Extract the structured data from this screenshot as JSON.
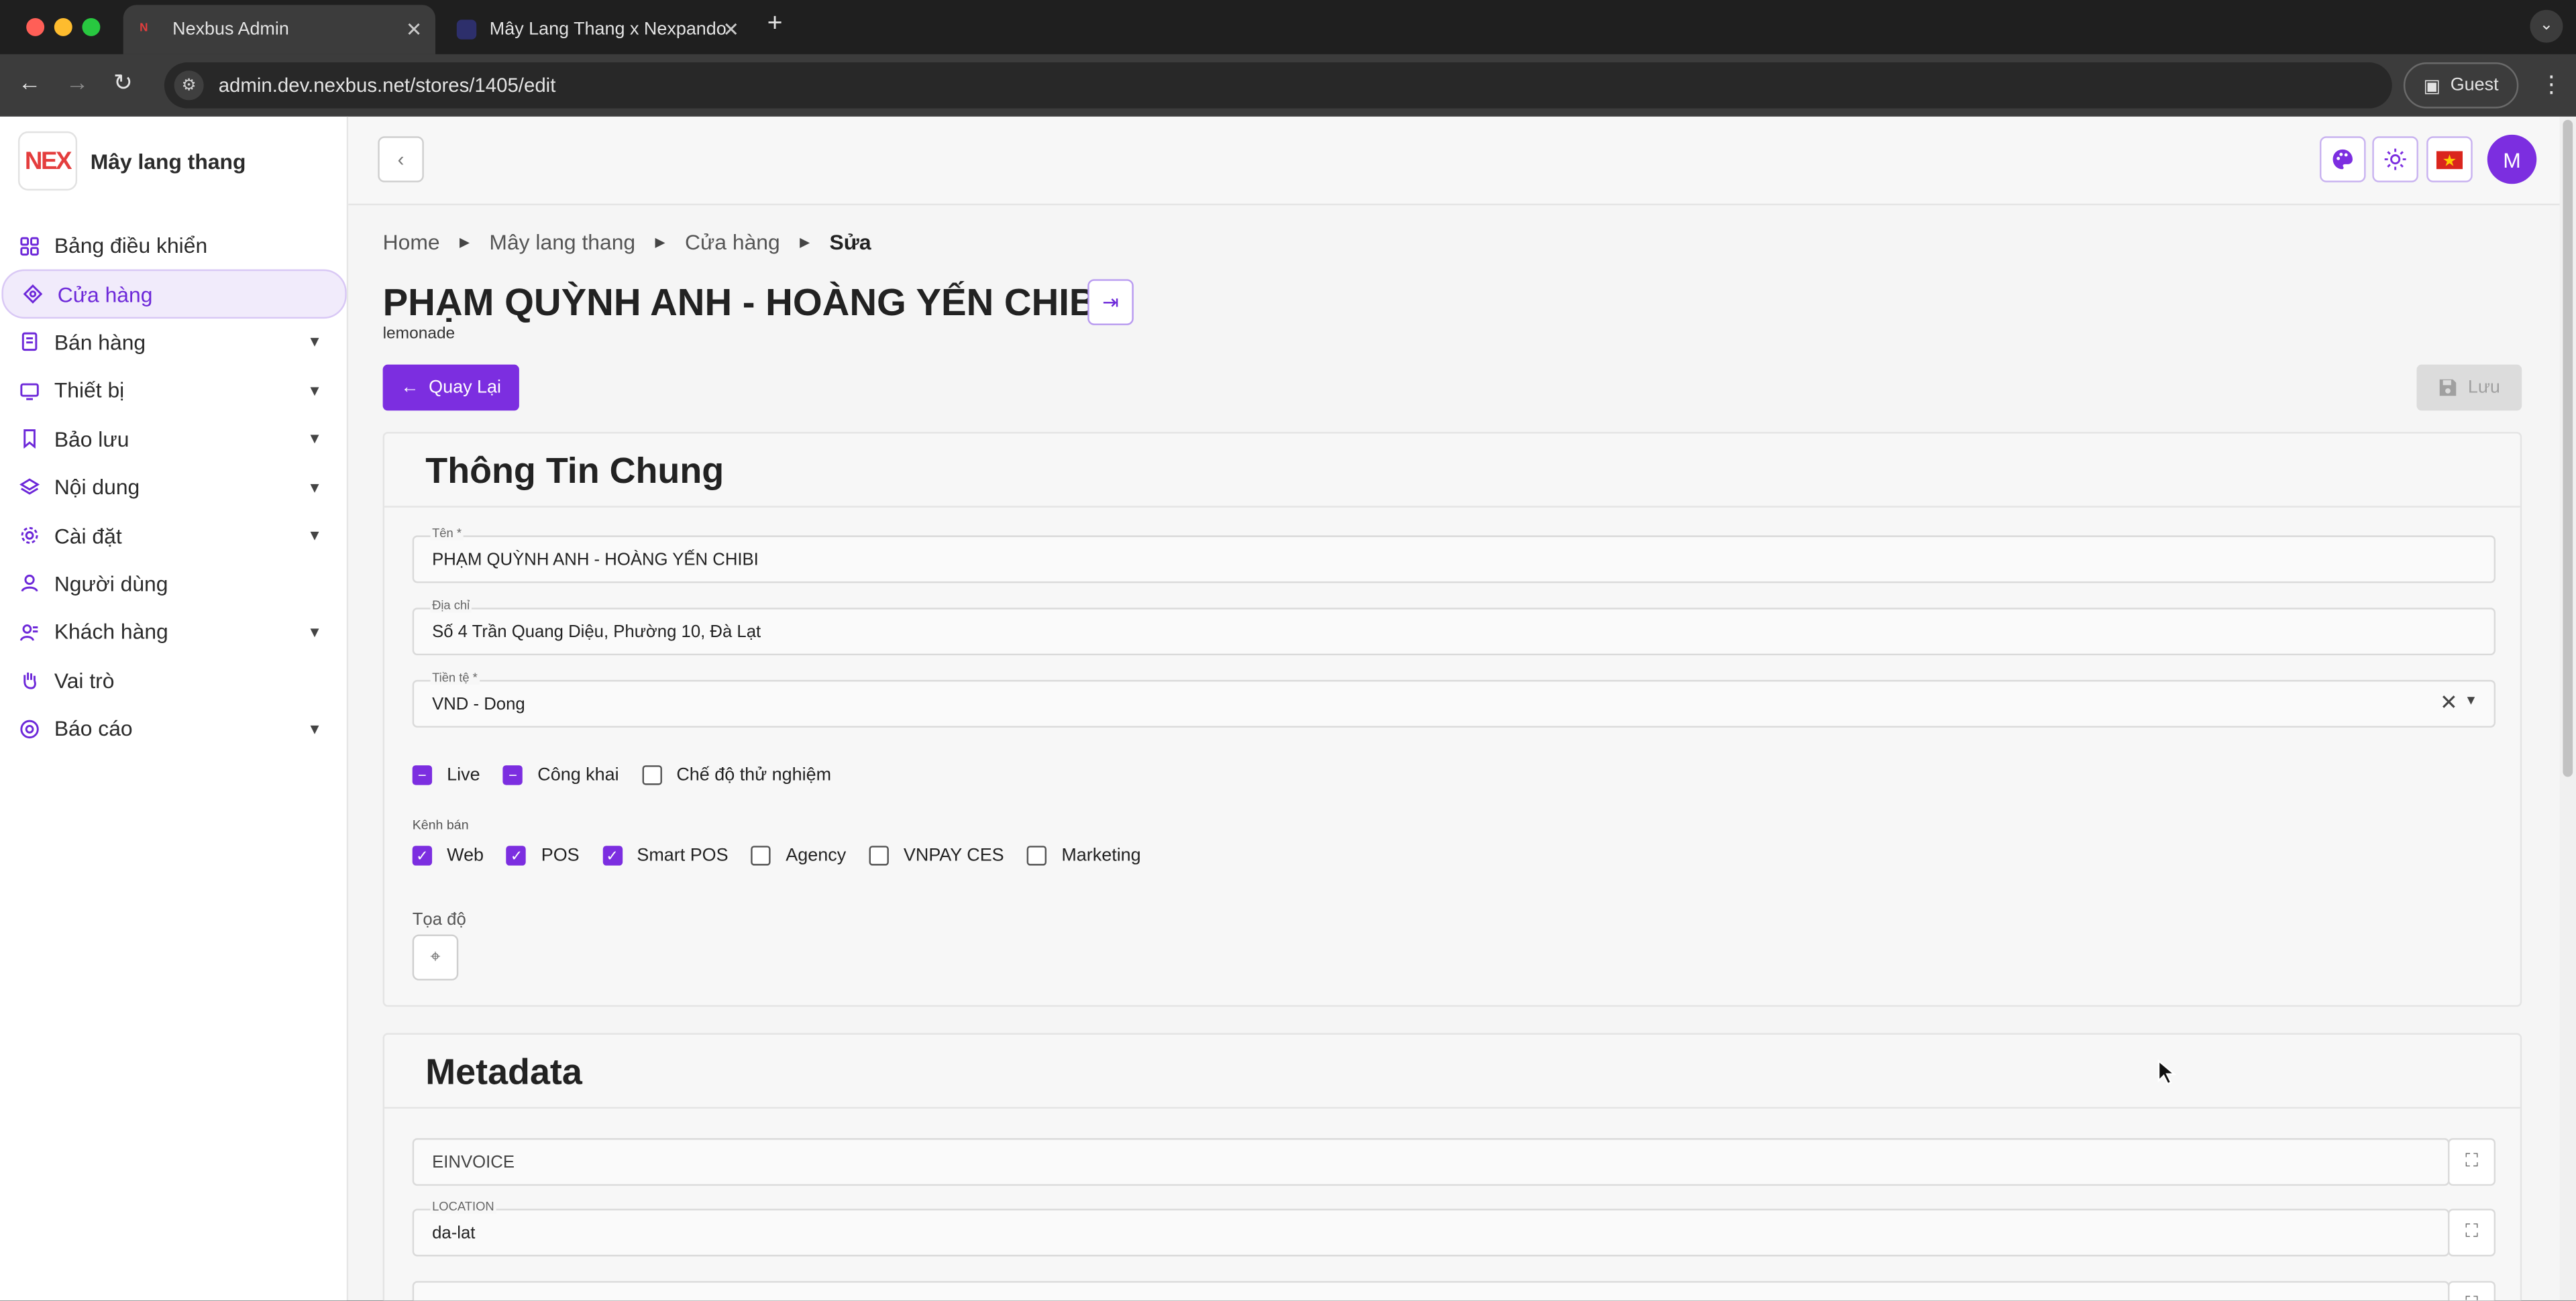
{
  "browser": {
    "tabs": [
      {
        "title": "Nexbus Admin",
        "active": true
      },
      {
        "title": "Mây Lang Thang x Nexpando",
        "active": false
      }
    ],
    "url": "admin.dev.nexbus.net/stores/1405/edit",
    "profile_label": "Guest"
  },
  "sidebar": {
    "brand_logo": "NEX",
    "brand_name": "Mây lang thang",
    "items": [
      {
        "label": "Bảng điều khiển",
        "icon": "grid-icon",
        "expandable": false,
        "active": false
      },
      {
        "label": "Cửa hàng",
        "icon": "store-icon",
        "expandable": false,
        "active": true
      },
      {
        "label": "Bán hàng",
        "icon": "receipt-icon",
        "expandable": true,
        "active": false
      },
      {
        "label": "Thiết bị",
        "icon": "monitor-icon",
        "expandable": true,
        "active": false
      },
      {
        "label": "Bảo lưu",
        "icon": "bookmark-icon",
        "expandable": true,
        "active": false
      },
      {
        "label": "Nội dung",
        "icon": "layers-icon",
        "expandable": true,
        "active": false
      },
      {
        "label": "Cài đặt",
        "icon": "gear-icon",
        "expandable": true,
        "active": false
      },
      {
        "label": "Người dùng",
        "icon": "user-icon",
        "expandable": false,
        "active": false
      },
      {
        "label": "Khách hàng",
        "icon": "users-icon",
        "expandable": true,
        "active": false
      },
      {
        "label": "Vai trò",
        "icon": "hand-icon",
        "expandable": false,
        "active": false
      },
      {
        "label": "Báo cáo",
        "icon": "report-icon",
        "expandable": true,
        "active": false
      }
    ]
  },
  "topbar": {
    "avatar_initial": "M",
    "buttons": [
      "palette-icon",
      "sun-icon",
      "vietnam-flag-icon"
    ]
  },
  "breadcrumb": [
    "Home",
    "Mây lang thang",
    "Cửa hàng",
    "Sửa"
  ],
  "store": {
    "title": "PHẠM QUỲNH ANH - HOÀNG YẾN CHIBI",
    "subtitle": "lemonade"
  },
  "actions": {
    "back_label": "Quay Lại",
    "save_label": "Lưu"
  },
  "general": {
    "title": "Thông Tin Chung",
    "name_label": "Tên *",
    "name_value": "PHẠM QUỲNH ANH - HOÀNG YẾN CHIBI",
    "address_label": "Địa chỉ",
    "address_value": "Số 4 Trần Quang Diệu, Phường 10, Đà Lạt",
    "currency_label": "Tiền tệ *",
    "currency_value": "VND - Dong",
    "flags": [
      {
        "label": "Live",
        "state": "indeterminate"
      },
      {
        "label": "Công khai",
        "state": "indeterminate"
      },
      {
        "label": "Chế độ thử nghiệm",
        "state": "unchecked"
      }
    ],
    "channels_label": "Kênh bán",
    "channels": [
      {
        "label": "Web",
        "checked": true
      },
      {
        "label": "POS",
        "checked": true
      },
      {
        "label": "Smart POS",
        "checked": true
      },
      {
        "label": "Agency",
        "checked": false
      },
      {
        "label": "VNPAY CES",
        "checked": false
      },
      {
        "label": "Marketing",
        "checked": false
      }
    ],
    "coords_label": "Tọa độ"
  },
  "metadata": {
    "title": "Metadata",
    "fields": [
      {
        "label": "",
        "placeholder": "EINVOICE",
        "value": ""
      },
      {
        "label": "LOCATION",
        "placeholder": "",
        "value": "da-lat"
      }
    ]
  },
  "colors": {
    "accent": "#7c2ee0",
    "accent_light": "#f1ebfb"
  }
}
